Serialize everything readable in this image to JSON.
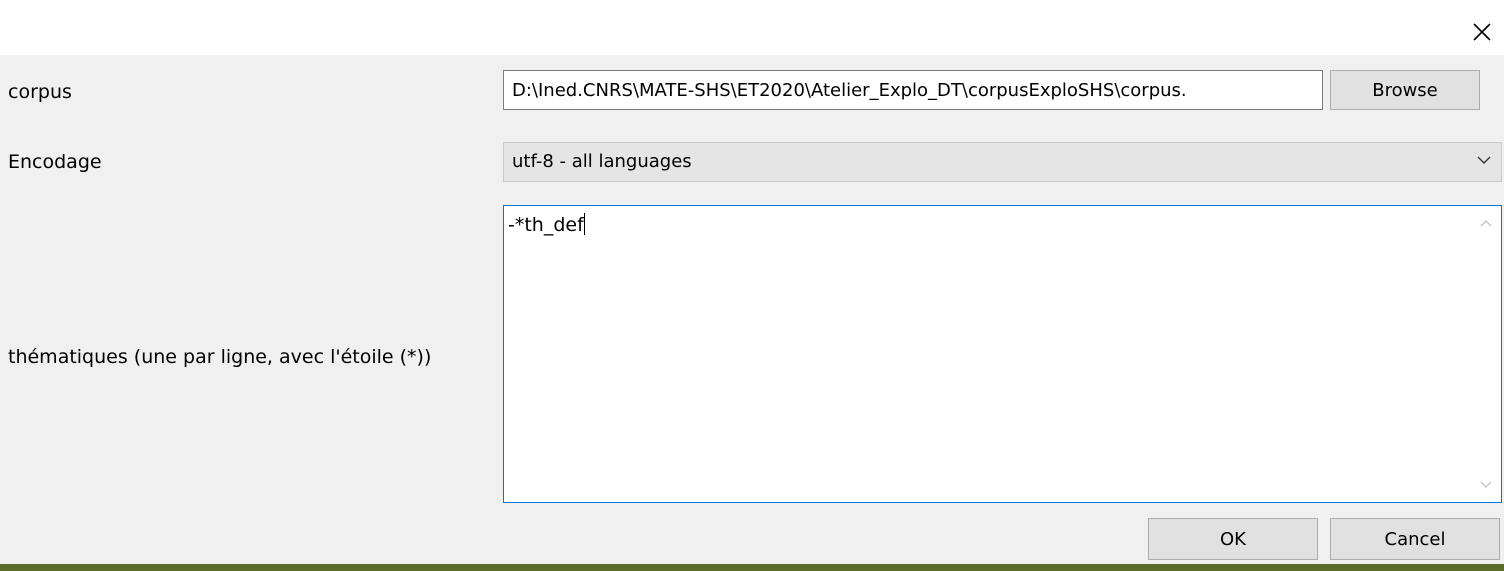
{
  "dialog": {
    "close_icon": "close-icon"
  },
  "form": {
    "corpus_label": "corpus",
    "corpus_path": "D:\\Ined.CNRS\\MATE-SHS\\ET2020\\Atelier_Explo_DT\\corpusExploSHS\\corpus.",
    "browse_label": "Browse",
    "encoding_label": "Encodage",
    "encoding_value": "utf-8 - all languages",
    "themes_label": "thématiques (une par ligne, avec l'étoile (*))",
    "themes_text": "-*th_def"
  },
  "buttons": {
    "ok_label": "OK",
    "cancel_label": "Cancel"
  },
  "colors": {
    "panel_bg": "#f0f0f0",
    "focus_border": "#0078d7",
    "bottom_strip": "#5b6b28"
  }
}
